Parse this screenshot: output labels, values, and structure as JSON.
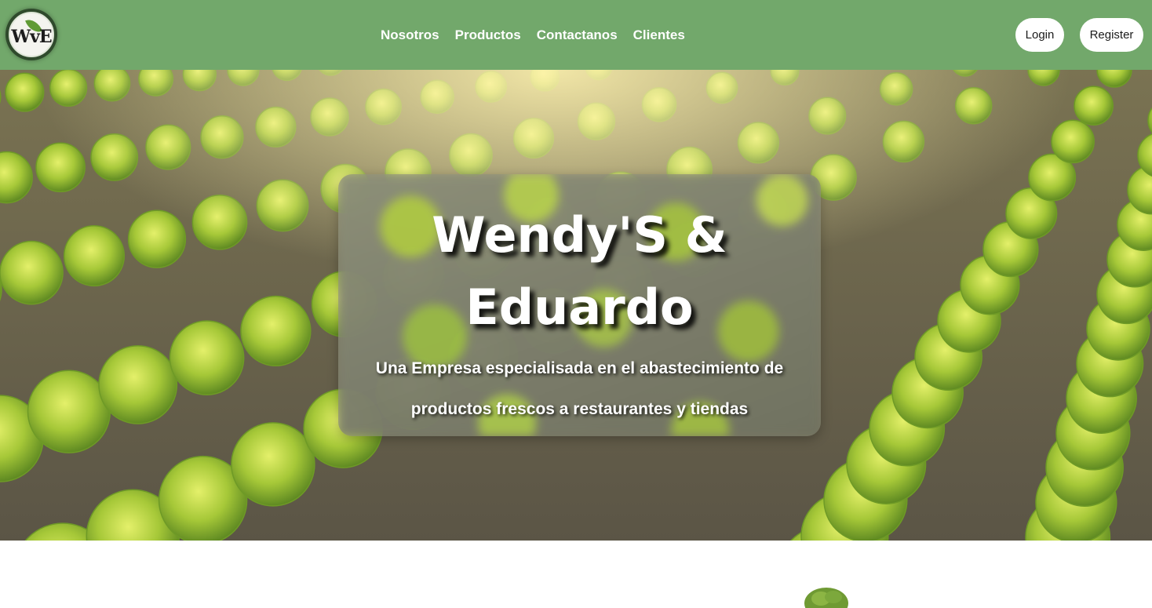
{
  "header": {
    "logo_text": "WvE",
    "nav": [
      {
        "label": "Nosotros"
      },
      {
        "label": "Productos"
      },
      {
        "label": "Contactanos"
      },
      {
        "label": "Clientes"
      }
    ],
    "login_label": "Login",
    "register_label": "Register"
  },
  "hero": {
    "title": "Wendy'S & Eduardo",
    "subtitle": "Una Empresa especialisada en el abastecimiento de productos frescos a restaurantes y tiendas",
    "background": "lettuce-field-photo"
  },
  "colors": {
    "navbar": "#72a86b",
    "button_bg": "#ffffff",
    "text_light": "#ffffff",
    "lettuce": "#a9cc3a"
  }
}
